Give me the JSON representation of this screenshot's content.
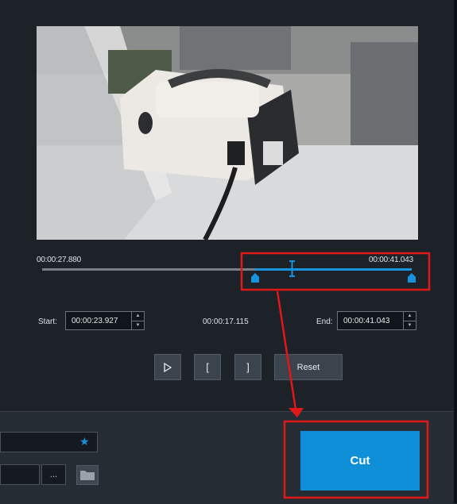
{
  "video": {
    "frame_description_icon": "video-frame"
  },
  "timeline": {
    "left_time": "00:00:27.880",
    "right_time": "00:00:41.043"
  },
  "trim": {
    "start_label": "Start:",
    "start_value": "00:00:23.927",
    "duration": "00:00:17.115",
    "end_label": "End:",
    "end_value": "00:00:41.043"
  },
  "controls": {
    "play_icon": "play-icon",
    "mark_in": "[",
    "mark_out": "]",
    "reset_label": "Reset"
  },
  "output": {
    "browse_label": "...",
    "folder_icon": "folder-icon",
    "star_icon": "star-icon",
    "cut_label": "Cut"
  },
  "colors": {
    "accent": "#0e8fd8",
    "annotation": "#e01818",
    "background": "#1d2229"
  }
}
